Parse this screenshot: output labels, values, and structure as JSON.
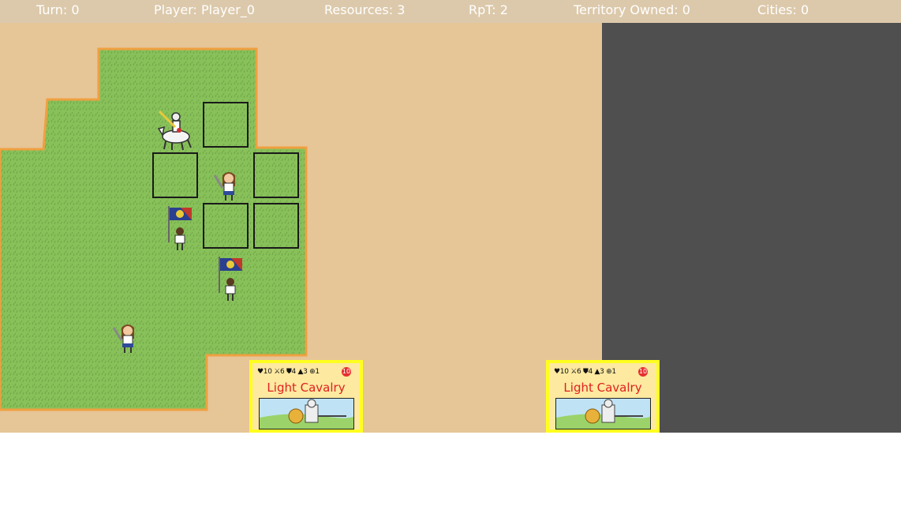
{
  "hud": {
    "turn": "Turn: 0",
    "player": "Player: Player_0",
    "resources": "Resources: 3",
    "rpt": "RpT: 2",
    "territory": "Territory Owned: 0",
    "cities": "Cities: 0"
  },
  "colors": {
    "grass": "#88c05a",
    "sand": "#e6c597",
    "void": "#4f4f4f",
    "card_border": "#ffff1f",
    "card_title": "#e02020"
  },
  "units": [
    {
      "kind": "light-cavalry-unit"
    },
    {
      "kind": "swordswoman-unit"
    },
    {
      "kind": "flag-bearer-unit"
    },
    {
      "kind": "flag-bearer-unit"
    },
    {
      "kind": "swordswoman-unit"
    }
  ],
  "hand": [
    {
      "title": "Light Cavalry",
      "health": "10",
      "attack": "6",
      "defense": "4",
      "movement": "3",
      "range": "1",
      "cost": "10"
    },
    {
      "title": "Light Cavalry",
      "health": "10",
      "attack": "6",
      "defense": "4",
      "movement": "3",
      "range": "1",
      "cost": "10"
    }
  ]
}
